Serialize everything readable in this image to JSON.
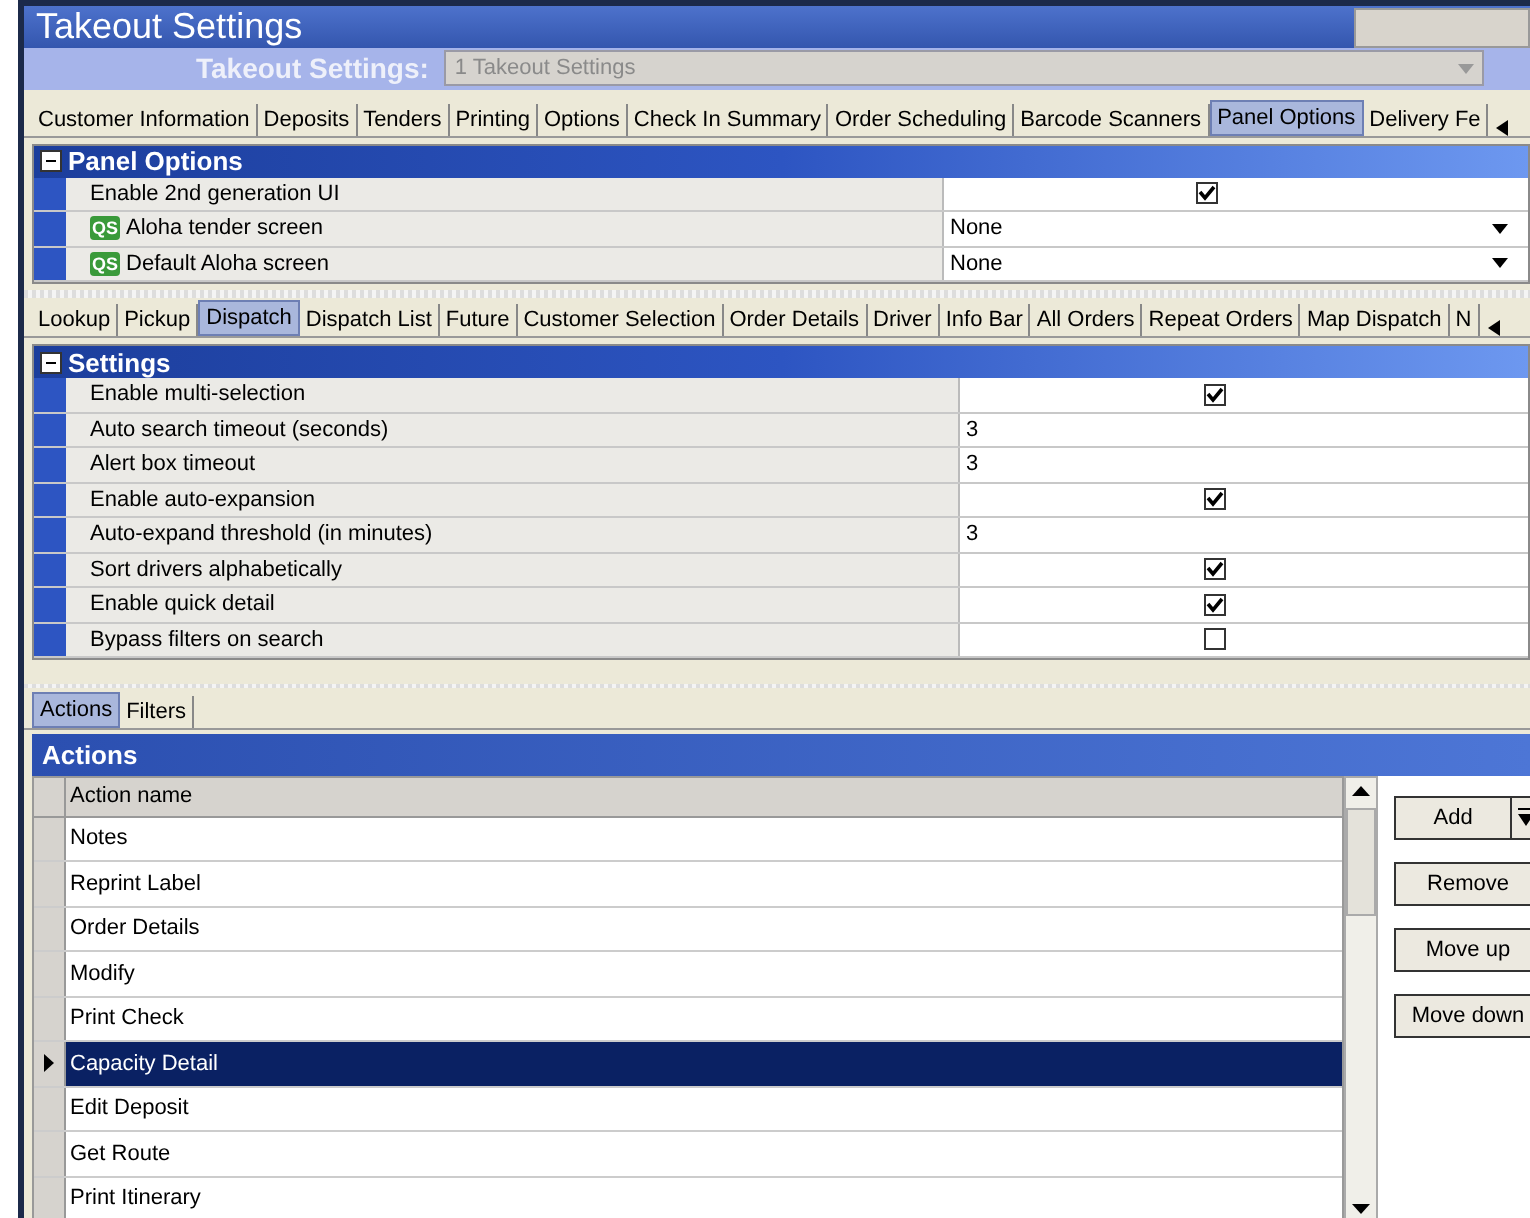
{
  "window": {
    "title": "Takeout Settings"
  },
  "selector": {
    "label": "Takeout Settings:",
    "value": "1 Takeout Settings"
  },
  "top_tabs": [
    {
      "label": "Customer Information",
      "selected": false
    },
    {
      "label": "Deposits",
      "selected": false
    },
    {
      "label": "Tenders",
      "selected": false
    },
    {
      "label": "Printing",
      "selected": false
    },
    {
      "label": "Options",
      "selected": false
    },
    {
      "label": "Check In Summary",
      "selected": false
    },
    {
      "label": "Order Scheduling",
      "selected": false
    },
    {
      "label": "Barcode Scanners",
      "selected": false
    },
    {
      "label": "Panel Options",
      "selected": true
    },
    {
      "label": "Delivery Fe",
      "selected": false
    }
  ],
  "panel_options": {
    "title": "Panel Options",
    "expanded": true,
    "rows": [
      {
        "label": "Enable 2nd generation UI",
        "kind": "checkbox",
        "checked": true
      },
      {
        "label": "Aloha tender screen",
        "kind": "dropdown",
        "value": "None",
        "icon": "QS"
      },
      {
        "label": "Default Aloha screen",
        "kind": "dropdown",
        "value": "None",
        "icon": "QS"
      }
    ]
  },
  "panel_tabs": [
    {
      "label": "Lookup",
      "selected": false
    },
    {
      "label": "Pickup",
      "selected": false
    },
    {
      "label": "Dispatch",
      "selected": true
    },
    {
      "label": "Dispatch List",
      "selected": false
    },
    {
      "label": "Future",
      "selected": false
    },
    {
      "label": "Customer Selection",
      "selected": false
    },
    {
      "label": "Order Details",
      "selected": false
    },
    {
      "label": "Driver",
      "selected": false
    },
    {
      "label": "Info Bar",
      "selected": false
    },
    {
      "label": "All Orders",
      "selected": false
    },
    {
      "label": "Repeat Orders",
      "selected": false
    },
    {
      "label": "Map Dispatch",
      "selected": false
    },
    {
      "label": "N",
      "selected": false
    }
  ],
  "settings": {
    "title": "Settings",
    "expanded": true,
    "rows": [
      {
        "label": "Enable multi-selection",
        "kind": "checkbox",
        "checked": true
      },
      {
        "label": "Auto search timeout (seconds)",
        "kind": "number",
        "value": "3"
      },
      {
        "label": "Alert box timeout",
        "kind": "number",
        "value": "3"
      },
      {
        "label": "Enable auto-expansion",
        "kind": "checkbox",
        "checked": true
      },
      {
        "label": "Auto-expand threshold (in minutes)",
        "kind": "number",
        "value": "3"
      },
      {
        "label": "Sort drivers alphabetically",
        "kind": "checkbox",
        "checked": true
      },
      {
        "label": "Enable quick detail",
        "kind": "checkbox",
        "checked": true
      },
      {
        "label": "Bypass filters on search",
        "kind": "checkbox",
        "checked": false
      }
    ]
  },
  "bottom_tabs": [
    {
      "label": "Actions",
      "selected": true
    },
    {
      "label": "Filters",
      "selected": false
    }
  ],
  "actions": {
    "title": "Actions",
    "column": "Action name",
    "rows": [
      {
        "name": "Notes",
        "selected": false
      },
      {
        "name": "Reprint Label",
        "selected": false
      },
      {
        "name": "Order Details",
        "selected": false
      },
      {
        "name": "Modify",
        "selected": false
      },
      {
        "name": "Print Check",
        "selected": false
      },
      {
        "name": "Capacity Detail",
        "selected": true
      },
      {
        "name": "Edit Deposit",
        "selected": false
      },
      {
        "name": "Get Route",
        "selected": false
      },
      {
        "name": "Print Itinerary",
        "selected": false
      }
    ],
    "buttons": [
      {
        "label": "Add",
        "kind": "split"
      },
      {
        "label": "Remove",
        "kind": "plain"
      },
      {
        "label": "Move up",
        "kind": "plain"
      },
      {
        "label": "Move down",
        "kind": "plain"
      }
    ]
  }
}
